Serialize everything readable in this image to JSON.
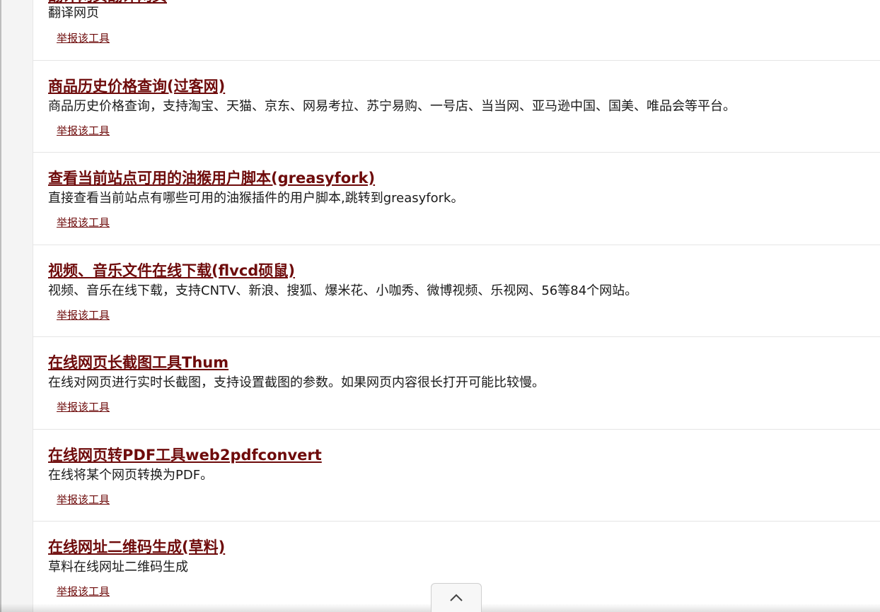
{
  "report_label": "举报该工具",
  "tools": [
    {
      "title": "翻译网页翻译网页",
      "desc": "翻译网页"
    },
    {
      "title": "商品历史价格查询(过客网)",
      "desc": "商品历史价格查询，支持淘宝、天猫、京东、网易考拉、苏宁易购、一号店、当当网、亚马逊中国、国美、唯品会等平台。"
    },
    {
      "title": "查看当前站点可用的油猴用户脚本(greasyfork)",
      "desc": "直接查看当前站点有哪些可用的油猴插件的用户脚本,跳转到greasyfork。"
    },
    {
      "title": "视频、音乐文件在线下载(flvcd硕鼠)",
      "desc": "视频、音乐在线下载，支持CNTV、新浪、搜狐、爆米花、小咖秀、微博视频、乐视网、56等84个网站。"
    },
    {
      "title": "在线网页长截图工具Thum",
      "desc": "在线对网页进行实时长截图，支持设置截图的参数。如果网页内容很长打开可能比较慢。"
    },
    {
      "title": "在线网页转PDF工具web2pdfconvert",
      "desc": "在线将某个网页转换为PDF。"
    },
    {
      "title": "在线网址二维码生成(草料)",
      "desc": "草料在线网址二维码生成"
    }
  ],
  "back_to_top_icon": "chevron-up-icon",
  "colors": {
    "title": "#6e0b0b",
    "text": "#1a1a1a",
    "divider": "#e5e5e5"
  }
}
